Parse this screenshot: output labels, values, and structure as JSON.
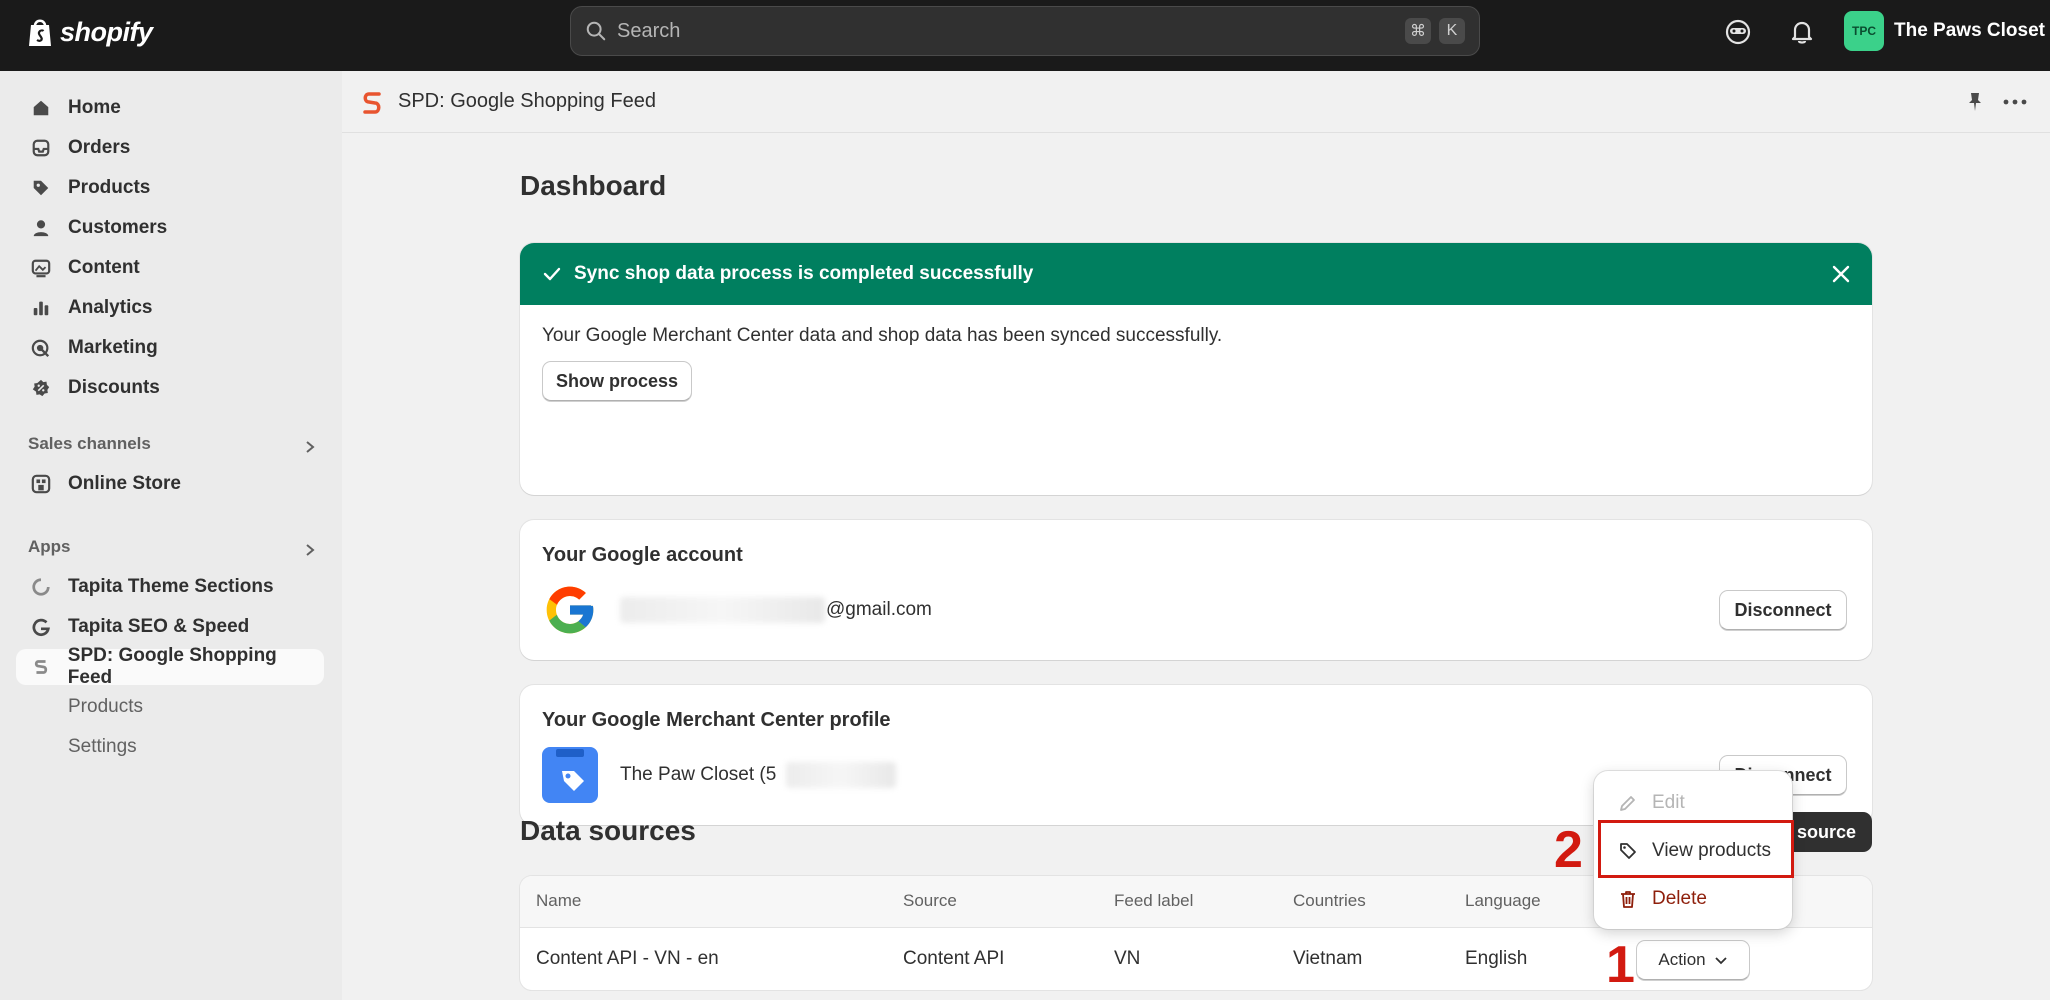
{
  "topbar": {
    "brand": "shopify",
    "search_placeholder": "Search",
    "shortcut_key1": "⌘",
    "shortcut_key2": "K",
    "store_initials": "TPC",
    "store_name": "The Paws Closet"
  },
  "sidebar": {
    "items": [
      {
        "label": "Home",
        "icon": "home-icon"
      },
      {
        "label": "Orders",
        "icon": "inbox-icon"
      },
      {
        "label": "Products",
        "icon": "tag-icon"
      },
      {
        "label": "Customers",
        "icon": "person-icon"
      },
      {
        "label": "Content",
        "icon": "image-icon"
      },
      {
        "label": "Analytics",
        "icon": "bar-chart-icon"
      },
      {
        "label": "Marketing",
        "icon": "target-icon"
      },
      {
        "label": "Discounts",
        "icon": "discount-icon"
      }
    ],
    "sales_channels_title": "Sales channels",
    "online_store": "Online Store",
    "apps_title": "Apps",
    "apps": [
      {
        "label": "Tapita Theme Sections"
      },
      {
        "label": "Tapita SEO & Speed"
      },
      {
        "label": "SPD: Google Shopping Feed"
      }
    ],
    "sub_items": [
      {
        "label": "Products"
      },
      {
        "label": "Settings"
      }
    ]
  },
  "app_header": {
    "title": "SPD: Google Shopping Feed"
  },
  "dashboard": {
    "title": "Dashboard",
    "banner_title": "Sync shop data process is completed successfully",
    "banner_message": "Your Google Merchant Center data and shop data has been synced successfully.",
    "show_process_label": "Show process",
    "google_account_title": "Your Google account",
    "google_email_suffix": "@gmail.com",
    "disconnect_label": "Disconnect",
    "merchant_title": "Your Google Merchant Center profile",
    "merchant_name": "The Paw Closet (5"
  },
  "data_sources": {
    "title": "Data sources",
    "add_button_tail": "source",
    "columns": [
      "Name",
      "Source",
      "Feed label",
      "Countries",
      "Language"
    ],
    "rows": [
      {
        "name": "Content API - VN - en",
        "source": "Content API",
        "feed_label": "VN",
        "countries": "Vietnam",
        "language": "English",
        "action": "Action"
      }
    ]
  },
  "action_menu": {
    "edit": "Edit",
    "view_products": "View products",
    "delete": "Delete"
  },
  "annotations": {
    "step1": "1",
    "step2": "2"
  },
  "colors": {
    "success": "#007f5f",
    "danger": "#8e1f0b",
    "annotation": "#d21a10"
  }
}
